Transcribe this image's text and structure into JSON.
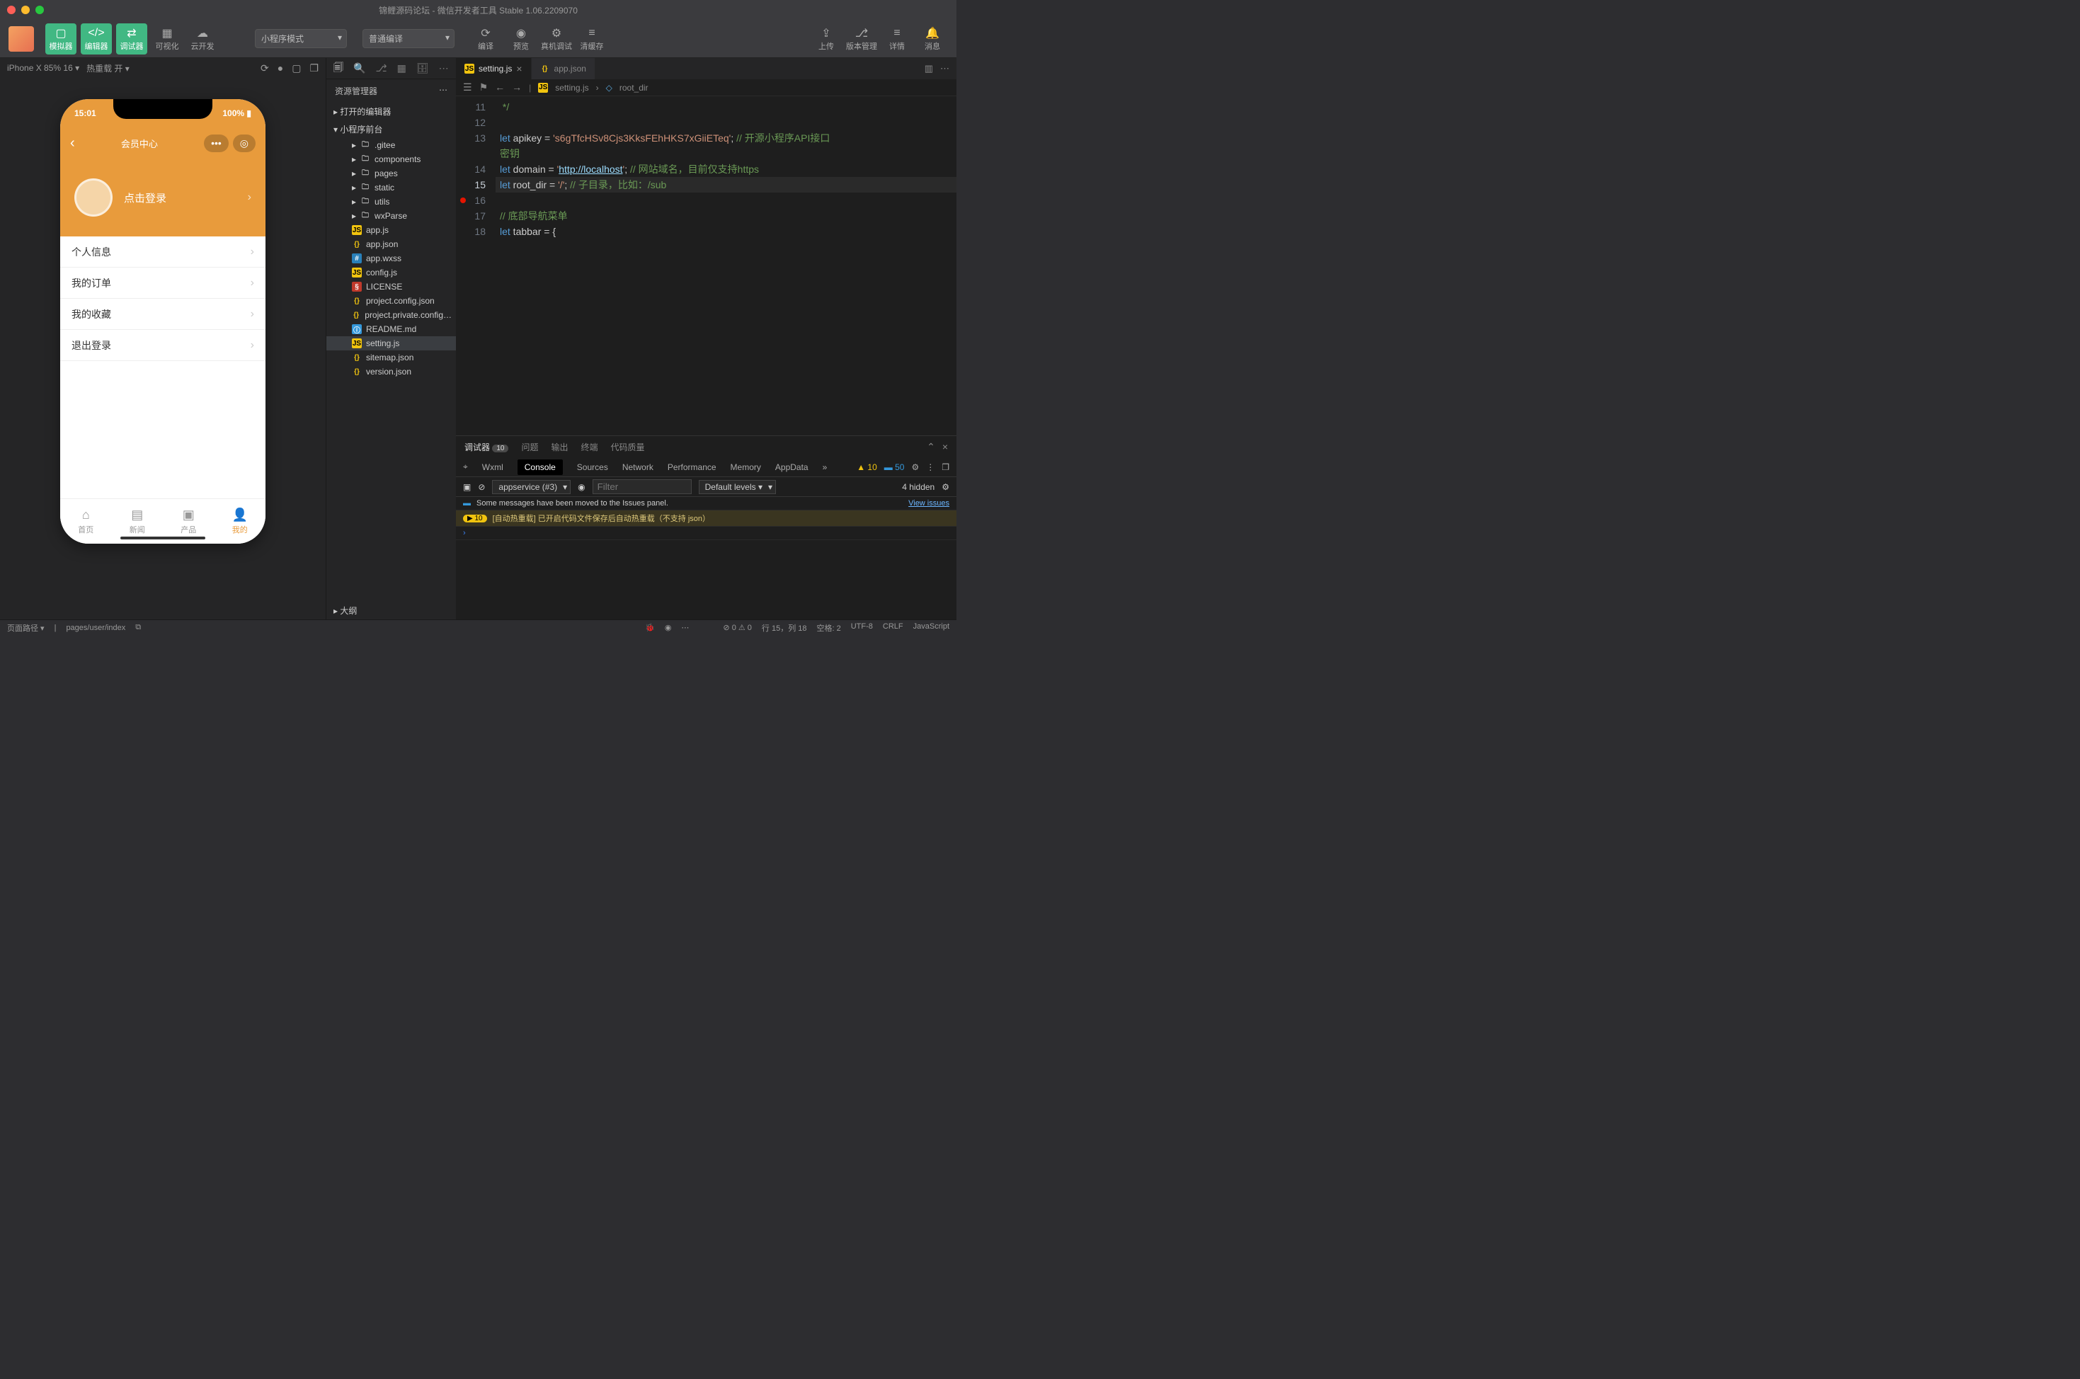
{
  "window_title": "锦鲤源码论坛 - 微信开发者工具 Stable 1.06.2209070",
  "toolbar": {
    "simulator": "模拟器",
    "editor": "编辑器",
    "debugger": "调试器",
    "visualize": "可视化",
    "clouddev": "云开发",
    "mode_select": "小程序模式",
    "compile_select": "普通编译",
    "compile": "编译",
    "preview": "预览",
    "realdebug": "真机调试",
    "clearcache": "清缓存",
    "upload": "上传",
    "version": "版本管理",
    "details": "详情",
    "messages": "消息"
  },
  "simbar": {
    "device": "iPhone X 85% 16 ▾",
    "hotreload": "热重载 开 ▾"
  },
  "phone": {
    "time": "15:01",
    "battery": "100%",
    "page_title": "会员中心",
    "login_cta": "点击登录",
    "menu": [
      "个人信息",
      "我的订单",
      "我的收藏",
      "退出登录"
    ],
    "tabs": [
      {
        "label": "首页"
      },
      {
        "label": "新闻"
      },
      {
        "label": "产品"
      },
      {
        "label": "我的"
      }
    ]
  },
  "explorer": {
    "title": "资源管理器",
    "open_editors": "打开的编辑器",
    "project": "小程序前台",
    "folders": [
      ".gitee",
      "components",
      "pages",
      "static",
      "utils",
      "wxParse"
    ],
    "files": [
      "app.js",
      "app.json",
      "app.wxss",
      "config.js",
      "LICENSE",
      "project.config.json",
      "project.private.config…",
      "README.md",
      "setting.js",
      "sitemap.json",
      "version.json"
    ],
    "outline": "大纲"
  },
  "tabs": {
    "active": "setting.js",
    "inactive": "app.json"
  },
  "breadcrumb": {
    "file": "setting.js",
    "symbol": "root_dir"
  },
  "code": {
    "lines": [
      {
        "n": 11,
        "t": " */"
      },
      {
        "n": 12,
        "t": ""
      },
      {
        "n": 13,
        "t": "let apikey = 's6gTfcHSv8Cjs3KksFEhHKS7xGiiETeq'; // 开源小程序API接口密钥"
      },
      {
        "n": 14,
        "t": "let domain = 'http://localhost'; // 网站域名，目前仅支持https"
      },
      {
        "n": 15,
        "t": "let root_dir = '/'; // 子目录，比如：/sub"
      },
      {
        "n": 16,
        "t": ""
      },
      {
        "n": 17,
        "t": "// 底部导航菜单"
      },
      {
        "n": 18,
        "t": "let tabbar = {"
      }
    ]
  },
  "debugger": {
    "tabs": {
      "main": "调试器",
      "badge": "10",
      "issues": "问题",
      "output": "输出",
      "terminal": "终端",
      "quality": "代码质量"
    },
    "devtabs": {
      "wxml": "Wxml",
      "console": "Console",
      "sources": "Sources",
      "network": "Network",
      "performance": "Performance",
      "memory": "Memory",
      "appdata": "AppData"
    },
    "warn_count": "10",
    "info_count": "50",
    "ctx": "appservice (#3)",
    "filter_placeholder": "Filter",
    "levels": "Default levels ▾",
    "hidden": "4 hidden",
    "msg1": "Some messages have been moved to the Issues panel.",
    "msg1_link": "View issues",
    "msg2_badge": "▶ 10",
    "msg2": "[自动热重载] 已开启代码文件保存后自动热重载（不支持 json）"
  },
  "statusbar": {
    "pagepath_label": "页面路径 ▾",
    "pagepath": "pages/user/index",
    "errwarn": "⊘ 0 ⚠ 0",
    "pos": "行 15，列 18",
    "spaces": "空格: 2",
    "encoding": "UTF-8",
    "eol": "CRLF",
    "lang": "JavaScript"
  }
}
